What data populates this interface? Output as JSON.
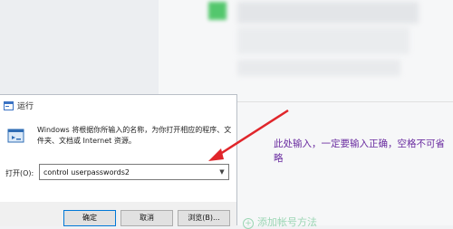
{
  "dialog": {
    "title": "运行",
    "description": "Windows 将根据你所输入的名称，为你打开相应的程序、文件夹、文档或 Internet 资源。",
    "open_label": "打开(O):",
    "open_value": "control userpasswords2",
    "ok_label": "确定",
    "cancel_label": "取消",
    "browse_label": "浏览(B)..."
  },
  "annotation": {
    "text": "此处输入，一定要输入正确，空格不可省略",
    "color": "#6a2ca0",
    "arrow_color": "#e0262b"
  },
  "background": {
    "bottom_link": "添加帐号方法"
  }
}
